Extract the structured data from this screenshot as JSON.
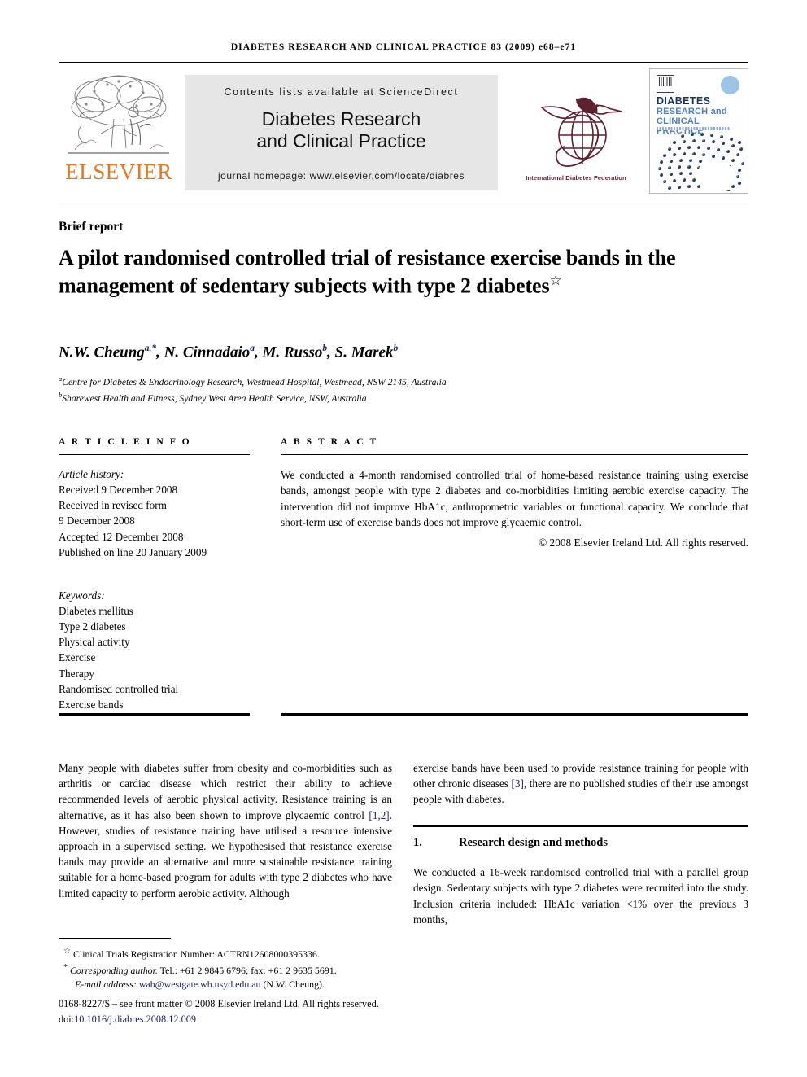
{
  "running_head": "DIABETES RESEARCH AND CLINICAL PRACTICE 83 (2009) e68–e71",
  "masthead": {
    "elsevier_wordmark": "ELSEVIER",
    "contents_line": "Contents lists available at ScienceDirect",
    "journal_title_line1": "Diabetes Research",
    "journal_title_line2": "and Clinical Practice",
    "homepage": "journal homepage: www.elsevier.com/locate/diabres",
    "idf_caption": "International Diabetes Federation",
    "cover": {
      "title1": "DIABETES",
      "title2": "RESEARCH and",
      "title3": "CLINICAL PRACTICE"
    }
  },
  "article": {
    "type_label": "Brief report",
    "title": "A pilot randomised controlled trial of resistance exercise bands in the management of sedentary subjects with type 2 diabetes",
    "title_footnote_mark": "☆",
    "authors_html": "N.W. Cheung<sup>a,*</sup>, N. Cinnadaio<sup>a</sup>, M. Russo<sup>b</sup>, S. Marek<sup>b</sup>",
    "affiliation_a": "Centre for Diabetes & Endocrinology Research, Westmead Hospital, Westmead, NSW 2145, Australia",
    "affiliation_b": "Sharewest Health and Fitness, Sydney West Area Health Service, NSW, Australia"
  },
  "article_info": {
    "heading": "A R T I C L E   I N F O",
    "history_label": "Article history:",
    "history": [
      "Received 9 December 2008",
      "Received in revised form",
      "9 December 2008",
      "Accepted 12 December 2008",
      "Published on line 20 January 2009"
    ],
    "keywords_label": "Keywords:",
    "keywords": [
      "Diabetes mellitus",
      "Type 2 diabetes",
      "Physical activity",
      "Exercise",
      "Therapy",
      "Randomised controlled trial",
      "Exercise bands"
    ]
  },
  "abstract": {
    "heading": "A B S T R A C T",
    "text": "We conducted a 4-month randomised controlled trial of home-based resistance training using exercise bands, amongst people with type 2 diabetes and co-morbidities limiting aerobic exercise capacity. The intervention did not improve HbA1c, anthropometric variables or functional capacity. We conclude that short-term use of exercise bands does not improve glycaemic control.",
    "copyright": "© 2008 Elsevier Ireland Ltd. All rights reserved."
  },
  "body": {
    "left_paragraph_part1": "Many people with diabetes suffer from obesity and co-morbidities such as arthritis or cardiac disease which restrict their ability to achieve recommended levels of aerobic physical activity. Resistance training is an alternative, as it has also been shown to improve glycaemic control ",
    "left_citation_1": "[1,2]",
    "left_paragraph_part2": ". However, studies of resistance training have utilised a resource intensive approach in a supervised setting. We hypothesised that resistance exercise bands may provide an alternative and more sustainable resistance training suitable for a home-based program for adults with type 2 diabetes who have limited capacity to perform aerobic activity. Although",
    "right_paragraph_part1": "exercise bands have been used to provide resistance training for people with other chronic diseases ",
    "right_citation_3": "[3]",
    "right_paragraph_part2": ", there are no published studies of their use amongst people with diabetes.",
    "section_number": "1.",
    "section_title": "Research design and methods",
    "section_paragraph": "We conducted a 16-week randomised controlled trial with a parallel group design. Sedentary subjects with type 2 diabetes were recruited into the study. Inclusion criteria included: HbA1c variation <1% over the previous 3 months,"
  },
  "footnotes": {
    "trial_registration_mark": "☆",
    "trial_registration": "Clinical Trials Registration Number: ACTRN12608000395336.",
    "corresponding_mark": "*",
    "corresponding_label": "Corresponding author.",
    "corresponding_rest": " Tel.: +61 2 9845 6796; fax: +61 2 9635 5691.",
    "email_label": "E-mail address:",
    "email": "wah@westgate.wh.usyd.edu.au",
    "email_attrib": "(N.W. Cheung).",
    "imprint_line": "0168-8227/$ – see front matter © 2008 Elsevier Ireland Ltd. All rights reserved.",
    "doi_label": "doi:",
    "doi": "10.1016/j.diabres.2008.12.009"
  },
  "colors": {
    "elsevier_orange": "#E87722",
    "link_blue": "#16205e",
    "idf_maroon": "#5d2230",
    "cover_navy": "#17365d",
    "cover_blue": "#4f81bd",
    "band_grey": "#e6e6e6"
  }
}
